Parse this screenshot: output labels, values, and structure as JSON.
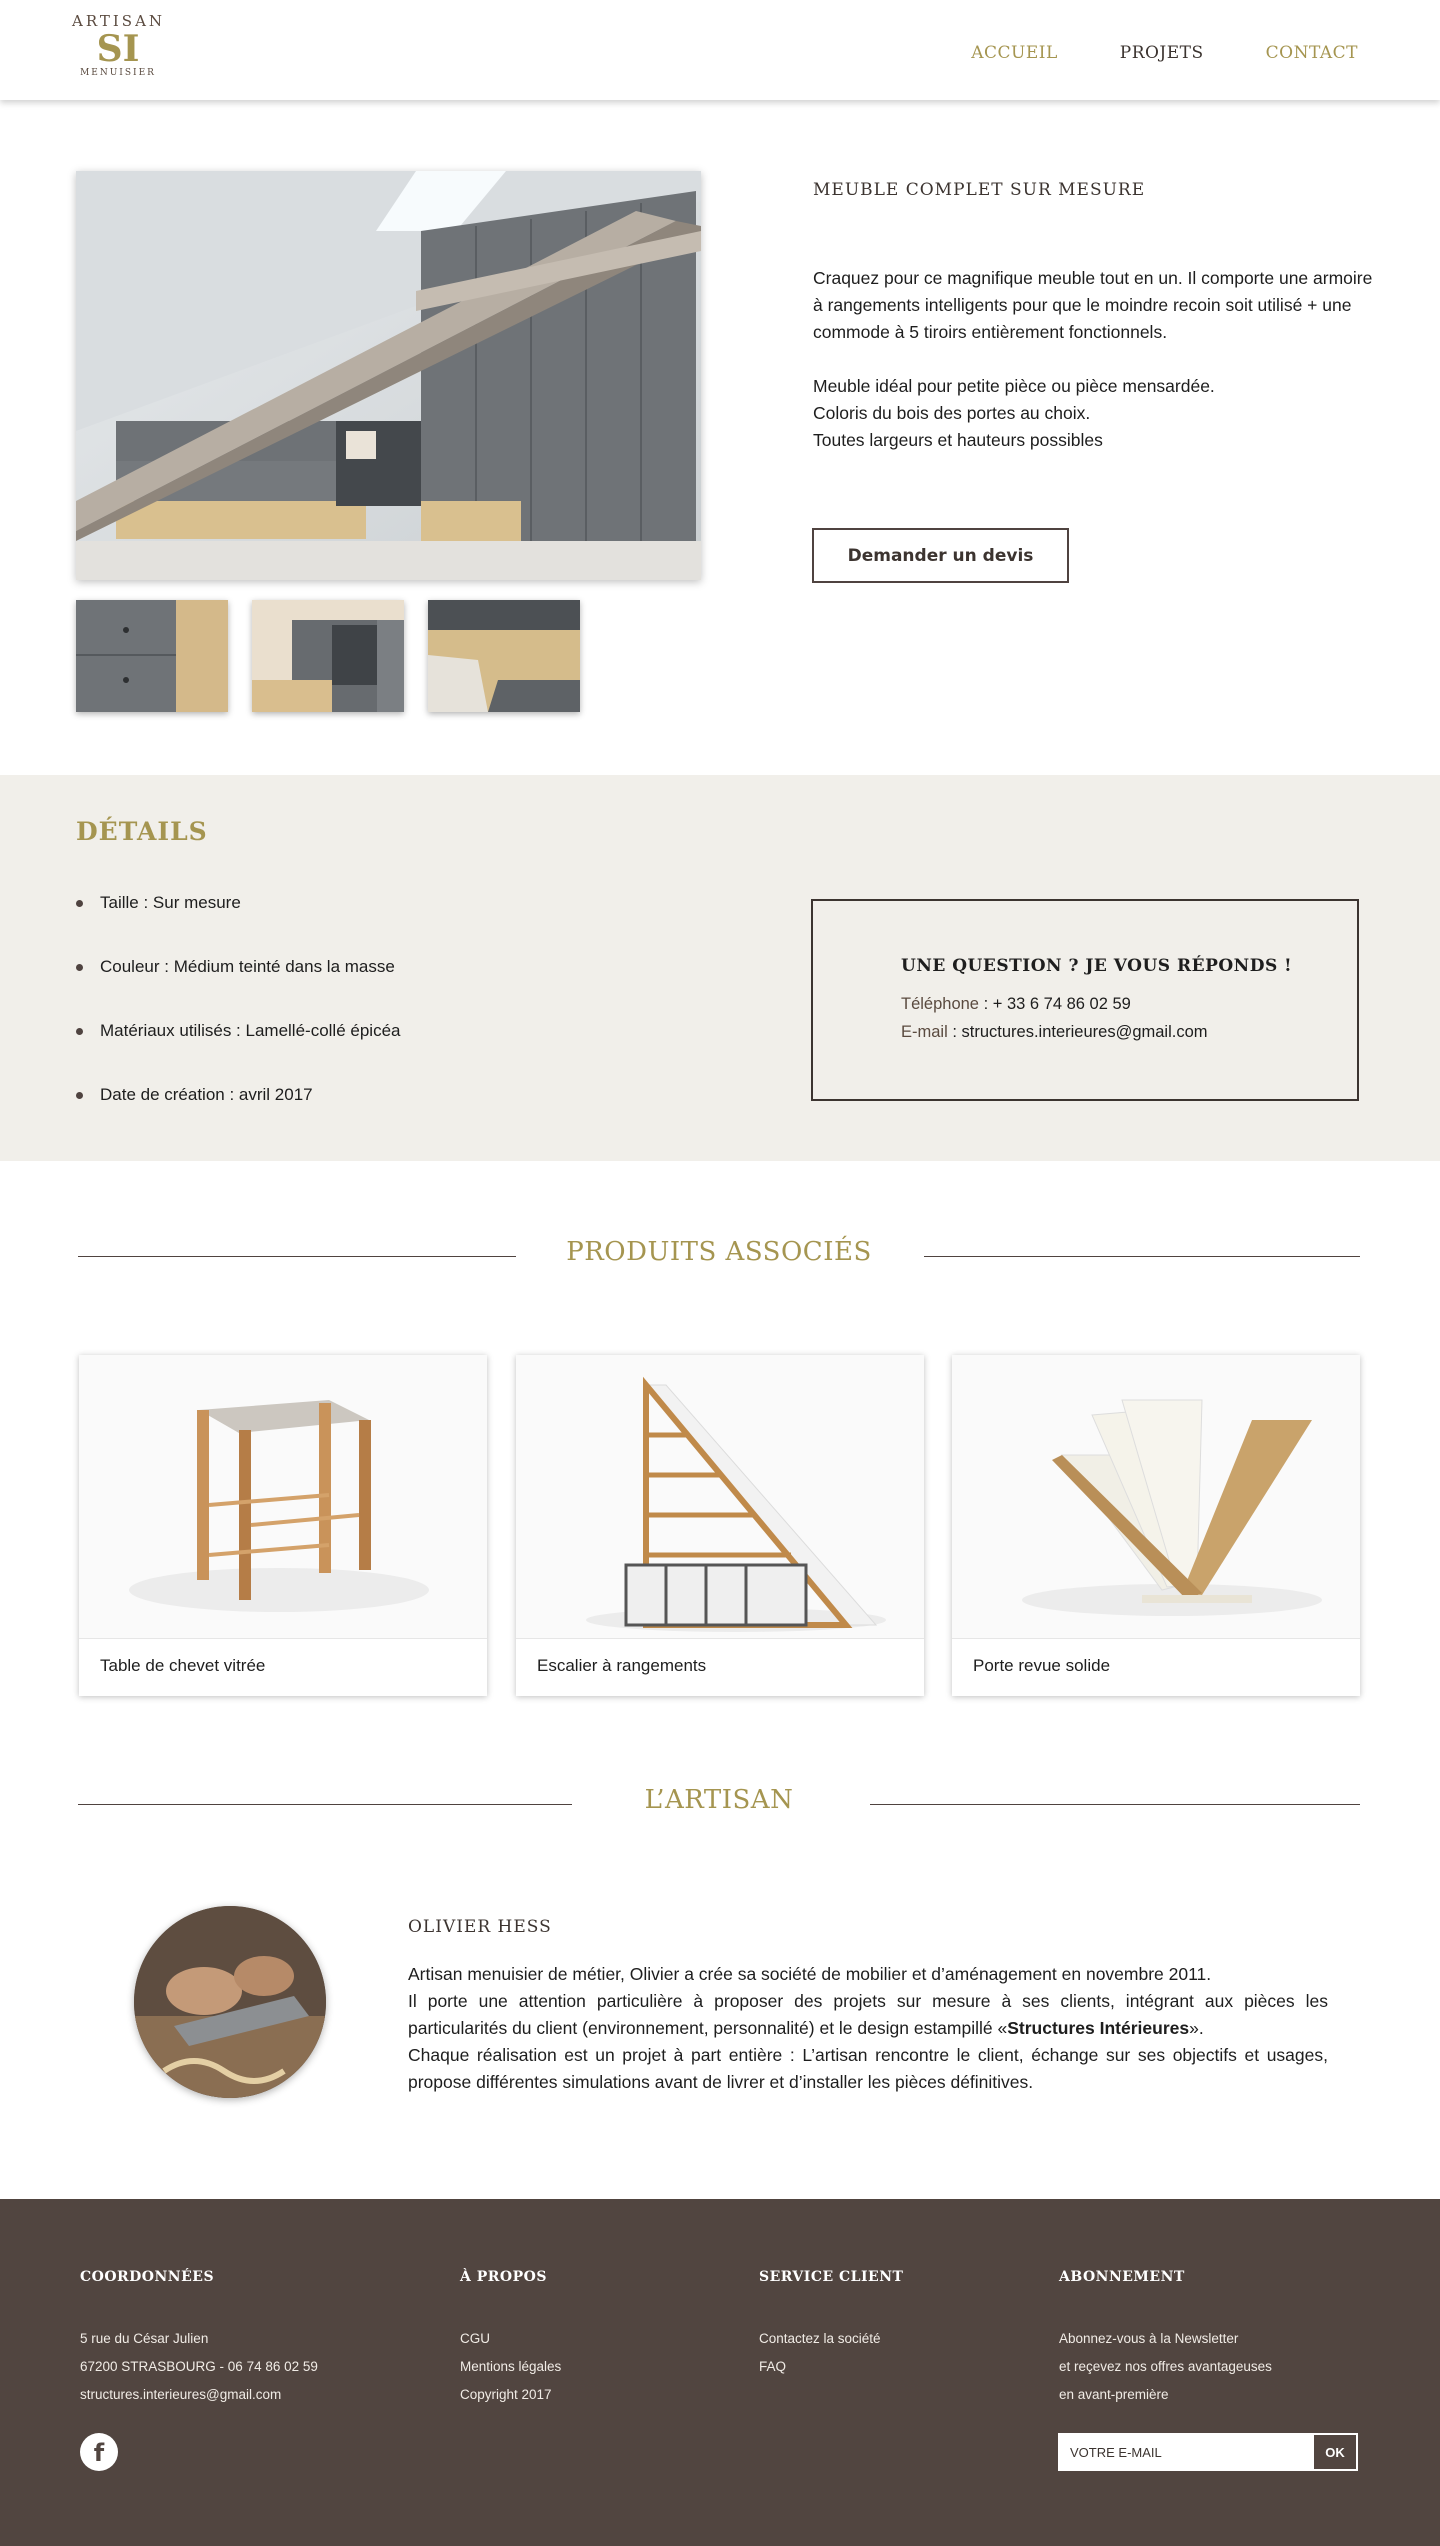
{
  "brand": {
    "logo_top": "ARTISAN",
    "logo_mid": "SI",
    "logo_bottom": "MENUISIER"
  },
  "nav": {
    "items": [
      "ACCUEIL",
      "PROJETS",
      "CONTACT"
    ],
    "active": "PROJETS"
  },
  "product": {
    "title": "MEUBLE COMPLET SUR MESURE",
    "description": [
      "Craquez pour ce magnifique meuble tout en un. Il comporte une armoire à rangements intelligents pour que le moindre recoin soit utilisé + une commode à 5 tiroirs entièrement fonctionnels.",
      "Meuble idéal pour petite pièce ou pièce mensardée.",
      "Coloris du bois des portes au choix.",
      "Toutes largeurs et hauteurs possibles"
    ],
    "cta": "Demander un devis"
  },
  "details": {
    "title": "DÉTAILS",
    "items": [
      "Taille : Sur mesure",
      "Couleur : Médium teinté dans la masse",
      "Matériaux utilisés : Lamellé-collé épicéa",
      "Date de création : avril 2017"
    ]
  },
  "contact_box": {
    "title": "UNE QUESTION ? JE VOUS RÉPONDS !",
    "phone_label": "Téléphone",
    "phone": " : + 33 6 74 86 02 59",
    "email_label": "E-mail",
    "email": " : structures.interieures@gmail.com"
  },
  "related": {
    "title": "PRODUITS ASSOCIÉS",
    "cards": [
      {
        "label": "Table de chevet vitrée"
      },
      {
        "label": "Escalier à rangements"
      },
      {
        "label": "Porte revue solide"
      }
    ]
  },
  "artisan": {
    "section_title": "L’ARTISAN",
    "name": "OLIVIER HESS",
    "bio_1": "Artisan menuisier de métier, Olivier a crée sa société de mobilier et d’aménagement en novembre 2011.",
    "bio_2a": "Il porte une attention particulière à proposer des projets sur mesure à ses clients, intégrant aux pièces les particularités du client (environnement, personnalité) et le design estampillé «",
    "bio_2b": "Structures Intérieures",
    "bio_2c": "».",
    "bio_3": "Chaque réalisation est un projet à part entière : L’artisan rencontre le client, échange sur ses objectifs et usages, propose différentes simulations avant de livrer et d’installer les pièces définitives."
  },
  "footer": {
    "coords": {
      "title": "COORDONNÉES",
      "lines": [
        "5 rue du César Julien",
        "67200 STRASBOURG - 06 74 86 02 59",
        "structures.interieures@gmail.com"
      ]
    },
    "about": {
      "title": "À PROPOS",
      "links": [
        "CGU",
        "Mentions légales",
        "Copyright 2017"
      ]
    },
    "service": {
      "title": "SERVICE CLIENT",
      "links": [
        "Contactez la société",
        "FAQ"
      ]
    },
    "newsletter": {
      "title": "ABONNEMENT",
      "lines": [
        "Abonnez-vous à la Newsletter",
        "et reçevez nos offres avantageuses",
        "en avant-première"
      ],
      "placeholder": "VOTRE E-MAIL",
      "button": "OK"
    },
    "facebook_icon": "facebook-icon"
  },
  "colors": {
    "accent_gold": "#a59550",
    "dark_brown": "#514540",
    "details_bg": "#f1efea"
  }
}
